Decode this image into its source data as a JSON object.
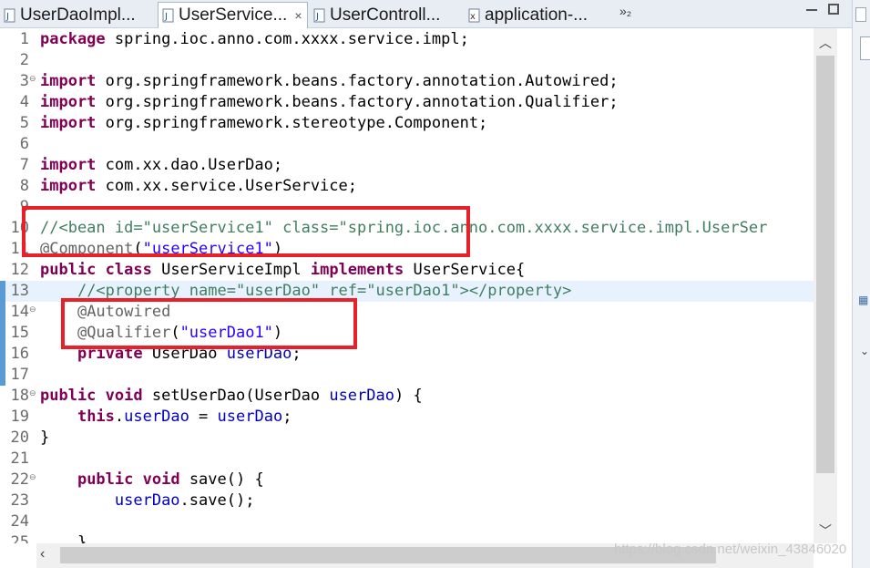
{
  "tabs": [
    {
      "label": "UserDaoImpl...",
      "icon": "java-file-icon",
      "active": false
    },
    {
      "label": "UserService...",
      "icon": "java-file-icon",
      "active": true,
      "close": "×"
    },
    {
      "label": "UserControll...",
      "icon": "java-file-icon",
      "active": false
    },
    {
      "label": "application-...",
      "icon": "xml-file-icon",
      "active": false
    }
  ],
  "overflow_indicator": "»₂",
  "code_lines": [
    {
      "num": "1",
      "html": "<span class='kw'>package</span> spring.ioc.anno.com.xxxx.service.impl;"
    },
    {
      "num": "2",
      "html": ""
    },
    {
      "num": "3",
      "fold": true,
      "html": "<span class='kw'>import</span> org.springframework.beans.factory.annotation.Autowired;"
    },
    {
      "num": "4",
      "html": "<span class='kw'>import</span> org.springframework.beans.factory.annotation.Qualifier;"
    },
    {
      "num": "5",
      "html": "<span class='kw'>import</span> org.springframework.stereotype.Component;"
    },
    {
      "num": "6",
      "html": ""
    },
    {
      "num": "7",
      "html": "<span class='kw'>import</span> com.xx.dao.UserDao;"
    },
    {
      "num": "8",
      "html": "<span class='kw'>import</span> com.xx.service.UserService;"
    },
    {
      "num": "9",
      "html": ""
    },
    {
      "num": "10",
      "html": "<span class='cm'>//&lt;bean id=\"userService1\" class=\"spring.ioc.anno.com.xxxx.service.impl.UserSer</span>"
    },
    {
      "num": "11",
      "html": "<span class='ann'>@Component</span>(<span class='str'>\"userService1\"</span>)"
    },
    {
      "num": "12",
      "html": "<span class='kw'>public</span> <span class='kw'>class</span> UserServiceImpl <span class='kw'>implements</span> UserService{"
    },
    {
      "num": "13",
      "current": true,
      "marker": true,
      "html": "    <span class='cm'>//&lt;property name=\"userDao\" ref=\"userDao1\"&gt;&lt;/property&gt;</span>"
    },
    {
      "num": "14",
      "fold": true,
      "marker": true,
      "html": "    <span class='ann'>@Autowired</span>"
    },
    {
      "num": "15",
      "marker": true,
      "html": "    <span class='ann'>@Qualifier</span>(<span class='str'>\"userDao1\"</span>)"
    },
    {
      "num": "16",
      "marker": true,
      "html": "    <span class='kw'>private</span> UserDao <span class='fld'>userDao</span>;"
    },
    {
      "num": "17",
      "marker": true,
      "html": ""
    },
    {
      "num": "18",
      "fold": true,
      "html": "<span class='kw'>public</span> <span class='kw'>void</span> setUserDao(UserDao <span class='fld'>userDao</span>) {"
    },
    {
      "num": "19",
      "html": "    <span class='kw'>this</span>.<span class='fld'>userDao</span> = <span class='fld'>userDao</span>;"
    },
    {
      "num": "20",
      "html": "}"
    },
    {
      "num": "21",
      "html": ""
    },
    {
      "num": "22",
      "fold": true,
      "html": "    <span class='kw'>public</span> <span class='kw'>void</span> save() {"
    },
    {
      "num": "23",
      "html": "        <span class='fld'>userDao</span>.save();"
    },
    {
      "num": "24",
      "html": ""
    },
    {
      "num": "25",
      "html": "    }"
    }
  ],
  "watermark": "https://blog.csdn.net/weixin_43846020",
  "colors": {
    "highlight_box": "#e8202a",
    "keyword": "#7f0055",
    "string": "#2a00ff",
    "comment": "#3f7f5f",
    "annotation": "#646464",
    "field": "#0000c0"
  }
}
